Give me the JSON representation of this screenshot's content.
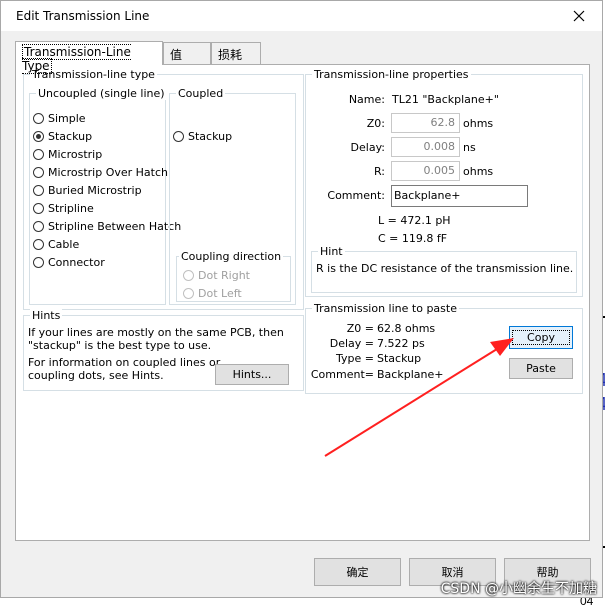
{
  "background_fragments": {
    "left_red_1": "2",
    "left_red_2": "8",
    "left_red_3": "6",
    "left_red_4": "5",
    "left_red_5": "o",
    "left_red_6": "t",
    "left_black_1": "2",
    "right_blue_1": "4",
    "right_blue_2": "4",
    "bottom_right": "04"
  },
  "dialog": {
    "title": "Edit Transmission Line",
    "close_icon": "close-icon"
  },
  "tabs": [
    {
      "label": "Transmission-Line Type",
      "active": true
    },
    {
      "label": "值",
      "active": false
    },
    {
      "label": "损耗",
      "active": false
    }
  ],
  "type_group": {
    "title": "Transmission-line type",
    "uncoupled": {
      "title": "Uncoupled  (single line)",
      "options": [
        {
          "label": "Simple",
          "checked": false
        },
        {
          "label": "Stackup",
          "checked": true
        },
        {
          "label": "Microstrip",
          "checked": false
        },
        {
          "label": "Microstrip Over Hatch",
          "checked": false
        },
        {
          "label": "Buried Microstrip",
          "checked": false
        },
        {
          "label": "Stripline",
          "checked": false
        },
        {
          "label": "Stripline Between Hatch",
          "checked": false
        },
        {
          "label": "Cable",
          "checked": false
        },
        {
          "label": "Connector",
          "checked": false
        }
      ]
    },
    "coupled": {
      "title": "Coupled",
      "options": [
        {
          "label": "Stackup",
          "checked": false
        }
      ],
      "coupling_direction": {
        "title": "Coupling direction",
        "options": [
          {
            "label": "Dot Right",
            "enabled": false
          },
          {
            "label": "Dot Left",
            "enabled": false
          }
        ]
      }
    }
  },
  "hints": {
    "title": "Hints",
    "text1_line1": "If your lines are mostly on the same PCB, then",
    "text1_line2": "\"stackup\" is the best type to use.",
    "text2_line1": "For information on coupled lines or",
    "text2_line2": "coupling dots, see Hints.",
    "button": "Hints..."
  },
  "properties": {
    "title": "Transmission-line properties",
    "name_label": "Name:",
    "name_value": "TL21 \"Backplane+\"",
    "z0_label": "Z0:",
    "z0_value": "62.8",
    "z0_unit": "ohms",
    "delay_label": "Delay:",
    "delay_value": "0.008",
    "delay_unit": "ns",
    "r_label": "R:",
    "r_value": "0.005",
    "r_unit": "ohms",
    "comment_label": "Comment:",
    "comment_value": "Backplane+",
    "l_line": "L =  472.1 pH",
    "c_line": "C =  119.8 fF",
    "hint_title": "Hint",
    "hint_text": "R is the DC resistance of the transmission line."
  },
  "paste": {
    "title": "Transmission line to paste",
    "z0_label": "Z0 =",
    "z0_value": "62.8 ohms",
    "delay_label": "Delay =",
    "delay_value": "7.522 ps",
    "type_label": "Type =",
    "type_value": "Stackup",
    "comment_label": "Comment=",
    "comment_value": "Backplane+",
    "copy_button": "Copy",
    "paste_button": "Paste"
  },
  "footer": {
    "ok": "确定",
    "cancel": "取消",
    "help": "帮助"
  },
  "watermark": "CSDN @小幽余生不加糖",
  "colors": {
    "arrow": "#ff2020",
    "focus_border": "#0078d7"
  }
}
